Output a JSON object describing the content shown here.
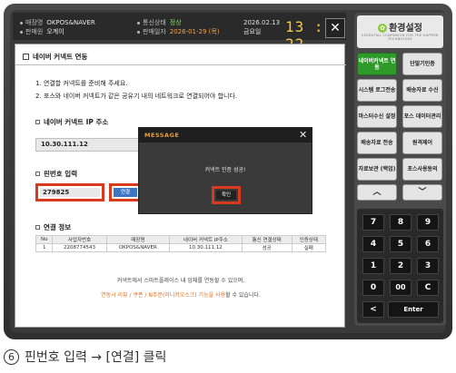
{
  "topbar": {
    "store_label": "매장명",
    "store_value": "OKPOS&NAVER",
    "owner_label": "판매원",
    "owner_value": "오계이",
    "comm_label": "통신상태",
    "comm_value": "정상",
    "open_label": "판매일자",
    "open_value": "2026-01-29 (목)",
    "date": "2026.02.13",
    "weekday": "금요일",
    "time": "13 : 22",
    "close_symbol": "✕"
  },
  "content": {
    "title": "네이버 커넥트 연동",
    "step1": "1. 연결할 커넥트를 준비해 주세요.",
    "step2": "2. 포스와 네이버 커넥트가 같은 공유기 내의 네트워크로 연결되어야 합니다.",
    "ip_section": "네이버 커넥트 IP 주소",
    "ip_value": "10.30.111.12",
    "pin_section": "핀번호 입력",
    "pin_value": "279825",
    "connect_label": "연결",
    "conn_info_section": "연결 정보",
    "table": {
      "headers": [
        "No",
        "사업자번호",
        "매장명",
        "네이버 커넥트 IP주소",
        "통신 연결상태",
        "인증상태"
      ],
      "rows": [
        [
          "1",
          "2208774543",
          "OKPOS&NAVER",
          "10.30.111.12",
          "성공",
          "실패"
        ]
      ]
    },
    "footer1": "커넥트에서 스마트플레이스 내 업체를 연동할 수 있으며,",
    "footer2_highlight": "연동시 리뷰 / 쿠폰 / N주문(미니키오스크) 기능을 사용",
    "footer2_rest": "할 수 있습니다."
  },
  "modal": {
    "title": "MESSAGE",
    "close_symbol": "✕",
    "message": "커넥트 인증 성공!",
    "ok_label": "확인"
  },
  "right_panel": {
    "logo_title": "환경설정",
    "logo_subtitle": "ESSENTIAL COMPANION FOR THE HAPPIER TECHNOLOGY",
    "menu": [
      {
        "label": "네이버커넥트 연동",
        "active": true
      },
      {
        "label": "단말기인증",
        "active": false
      },
      {
        "label": "시스템 로그전송",
        "active": false
      },
      {
        "label": "배송자료 수신",
        "active": false
      },
      {
        "label": "마스터수신 설정",
        "active": false
      },
      {
        "label": "포스 데이터관리",
        "active": false
      },
      {
        "label": "배송자료 전송",
        "active": false
      },
      {
        "label": "원격제어",
        "active": false
      },
      {
        "label": "자료보관 (백업)",
        "active": false
      },
      {
        "label": "포스사용동의",
        "active": false
      }
    ],
    "keys": [
      "7",
      "8",
      "9",
      "4",
      "5",
      "6",
      "1",
      "2",
      "3",
      "0",
      "00",
      "C",
      "<",
      "Enter"
    ],
    "up_arrow": "︿",
    "down_arrow": "﹀"
  },
  "caption": {
    "number": "6",
    "text": "핀번호 입력 → [연결] 클릭"
  },
  "colors": {
    "highlight_border": "#d9391d",
    "active_menu": "#2f9a2a",
    "connect_button": "#3d77c3",
    "time_color": "#f4c84c",
    "modal_title": "#e8a23b"
  }
}
